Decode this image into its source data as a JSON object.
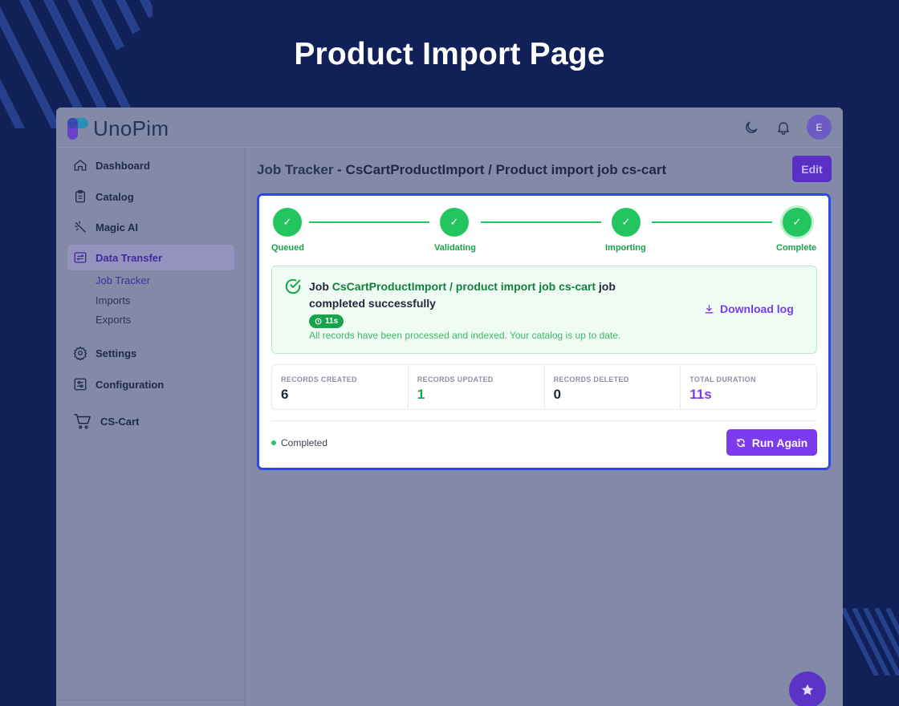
{
  "banner": {
    "title": "Product Import Page"
  },
  "app": {
    "logo_text": "UnoPim",
    "avatar_initial": "E"
  },
  "sidebar": {
    "items": [
      {
        "label": "Dashboard",
        "icon": "home-icon"
      },
      {
        "label": "Catalog",
        "icon": "clipboard-icon"
      },
      {
        "label": "Magic AI",
        "icon": "magic-wand-icon"
      },
      {
        "label": "Data Transfer",
        "icon": "transfer-icon",
        "active": true
      },
      {
        "label": "Settings",
        "icon": "gear-icon"
      },
      {
        "label": "Configuration",
        "icon": "sliders-icon"
      },
      {
        "label": "CS-Cart",
        "icon": "cart-icon"
      }
    ],
    "sub_items": [
      {
        "label": "Job Tracker",
        "active": true
      },
      {
        "label": "Imports"
      },
      {
        "label": "Exports"
      }
    ]
  },
  "header": {
    "title_prefix": "Job Tracker",
    "title_rest": " - CsCartProductImport / Product import job cs-cart",
    "edit_label": "Edit"
  },
  "steps": [
    {
      "label": "Queued"
    },
    {
      "label": "Validating"
    },
    {
      "label": "Importing"
    },
    {
      "label": "Complete"
    }
  ],
  "success": {
    "prefix": "Job ",
    "job_name": "CsCartProductImport / product import job cs-cart",
    "suffix": " job completed successfully",
    "duration_badge": "11s",
    "subtext": "All records have been processed and indexed. Your catalog is up to date.",
    "download_label": "Download log"
  },
  "stats": [
    {
      "label": "RECORDS CREATED",
      "value": "6"
    },
    {
      "label": "RECORDS UPDATED",
      "value": "1"
    },
    {
      "label": "RECORDS DELETED",
      "value": "0"
    },
    {
      "label": "TOTAL DURATION",
      "value": "11s"
    }
  ],
  "footer": {
    "status": "Completed",
    "run_again_label": "Run Again"
  },
  "colors": {
    "page_bg": "#112157",
    "accent": "#7c3aed",
    "success": "#22c55e",
    "card_border": "#2b48e6"
  }
}
